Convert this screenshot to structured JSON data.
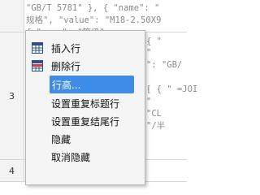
{
  "rows": [
    {
      "number": "",
      "lines": [
        "\"GB/T 5781\" }, { \"name\": \"",
        "规格\", \"value\": \"M18-2.50X9",
        "{ \"name\": \"等级\""
      ]
    },
    {
      "number": "3",
      "lines": [
        "{ \"",
        "\"",
        "\": \"GB/",
        "[ { \" =JOI",
        "\"",
        "\"CL",
        "\"/半"
      ]
    },
    {
      "number": "4",
      "lines": []
    }
  ],
  "context_menu": {
    "items": [
      {
        "label": "插入行",
        "icon": "insert-row-icon",
        "selected": false
      },
      {
        "label": "删除行",
        "icon": "delete-row-icon",
        "selected": false
      },
      {
        "label": "行高...",
        "icon": "",
        "selected": true
      },
      {
        "label": "设置重复标题行",
        "icon": "",
        "selected": false
      },
      {
        "label": "设置重复结尾行",
        "icon": "",
        "selected": false
      },
      {
        "label": "隐藏",
        "icon": "",
        "selected": false
      },
      {
        "label": "取消隐藏",
        "icon": "",
        "selected": false
      }
    ]
  },
  "colors": {
    "selection": "#3e8ce6",
    "menu_bg": "#f5f5f5"
  }
}
